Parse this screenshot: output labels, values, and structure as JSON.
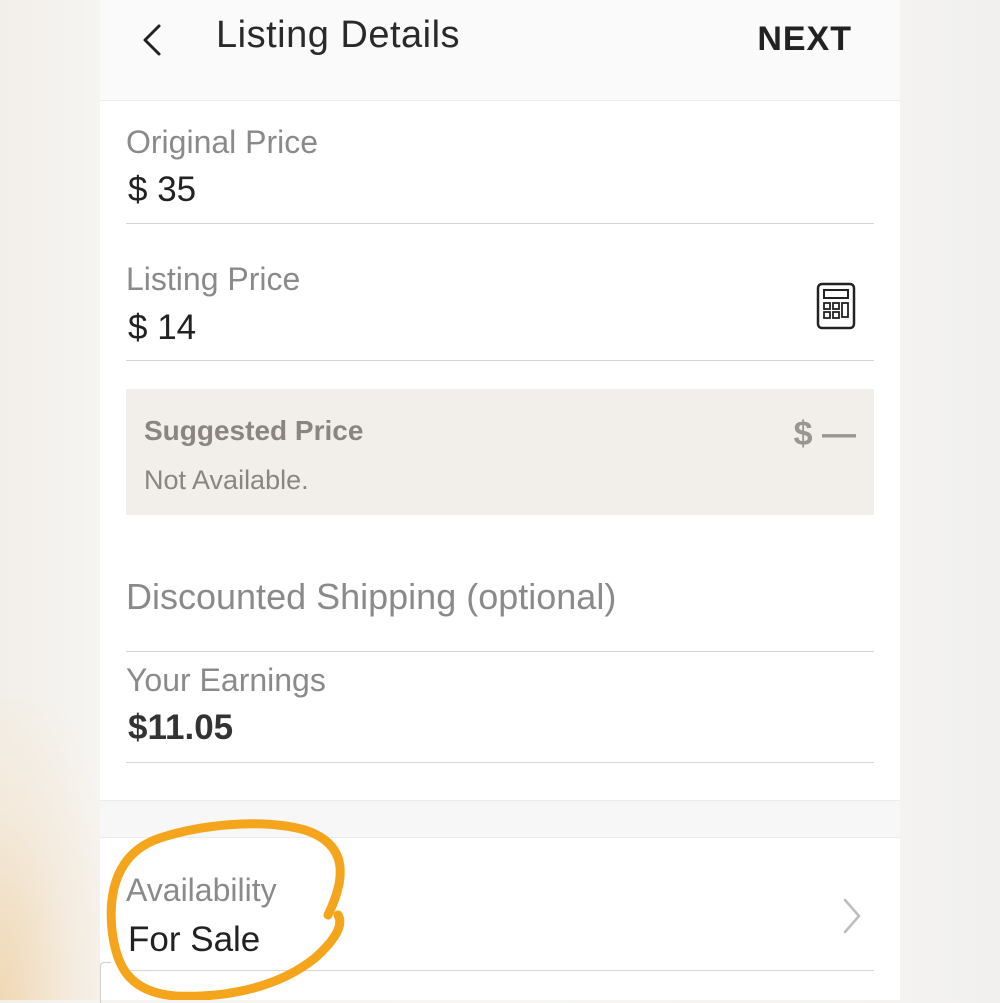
{
  "header": {
    "title": "Listing Details",
    "next_label": "NEXT"
  },
  "fields": {
    "original_price": {
      "label": "Original Price",
      "value": "$ 35"
    },
    "listing_price": {
      "label": "Listing Price",
      "value": "$ 14"
    },
    "suggested_price": {
      "title": "Suggested Price",
      "subtitle": "Not Available.",
      "value": "$ —"
    },
    "discounted_shipping": {
      "label": "Discounted Shipping (optional)"
    },
    "earnings": {
      "label": "Your Earnings",
      "value": "$11.05"
    },
    "availability": {
      "label": "Availability",
      "value": "For Sale"
    }
  },
  "icons": {
    "back": "chevron-left-icon",
    "calculator": "calculator-icon",
    "chevron": "chevron-right-icon"
  },
  "colors": {
    "annotation": "#f4a51c",
    "suggest_bg": "#f2efeb"
  }
}
